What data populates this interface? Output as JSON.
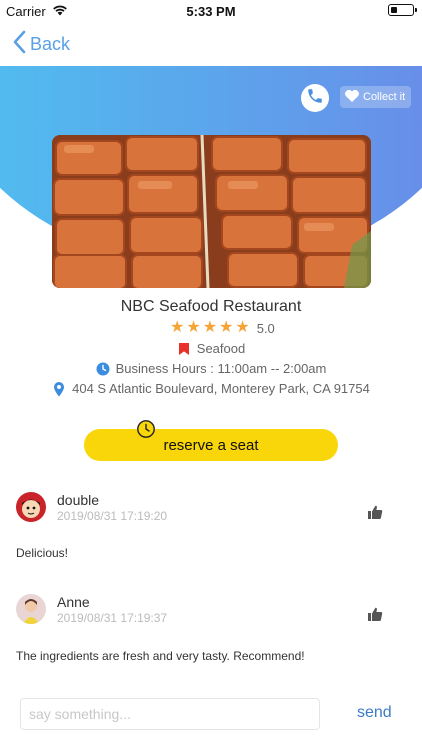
{
  "status_bar": {
    "carrier": "Carrier",
    "time": "5:33 PM"
  },
  "nav": {
    "back_label": "Back"
  },
  "actions": {
    "collect_label": "Collect it"
  },
  "restaurant": {
    "name": "NBC Seafood Restaurant",
    "rating": "5.0",
    "stars": 5,
    "category": "Seafood",
    "hours": "Business Hours : 11:00am -- 2:00am",
    "address": "404 S Atlantic Boulevard, Monterey Park, CA 91754"
  },
  "reserve": {
    "label": "reserve a seat"
  },
  "comments": [
    {
      "user": "double",
      "date": "2019/08/31 17:19:20",
      "text": "Delicious!"
    },
    {
      "user": "Anne",
      "date": "2019/08/31 17:19:37",
      "text": "The ingredients are fresh and very tasty. Recommend!"
    }
  ],
  "composer": {
    "placeholder": "say something...",
    "send_label": "send"
  },
  "colors": {
    "accent_blue": "#5aa0e6",
    "gradient_start": "#4fc1ef",
    "gradient_end": "#6b88e8",
    "star": "#f4a536",
    "reserve_yellow": "#f9d60a",
    "category_red": "#e8312a",
    "send_blue": "#3a7bc4"
  },
  "icons": [
    "wifi-icon",
    "battery-icon",
    "back-chevron-icon",
    "phone-icon",
    "heart-icon",
    "star-icon",
    "bookmark-icon",
    "clock-icon",
    "location-pin-icon",
    "thumbs-up-icon"
  ]
}
